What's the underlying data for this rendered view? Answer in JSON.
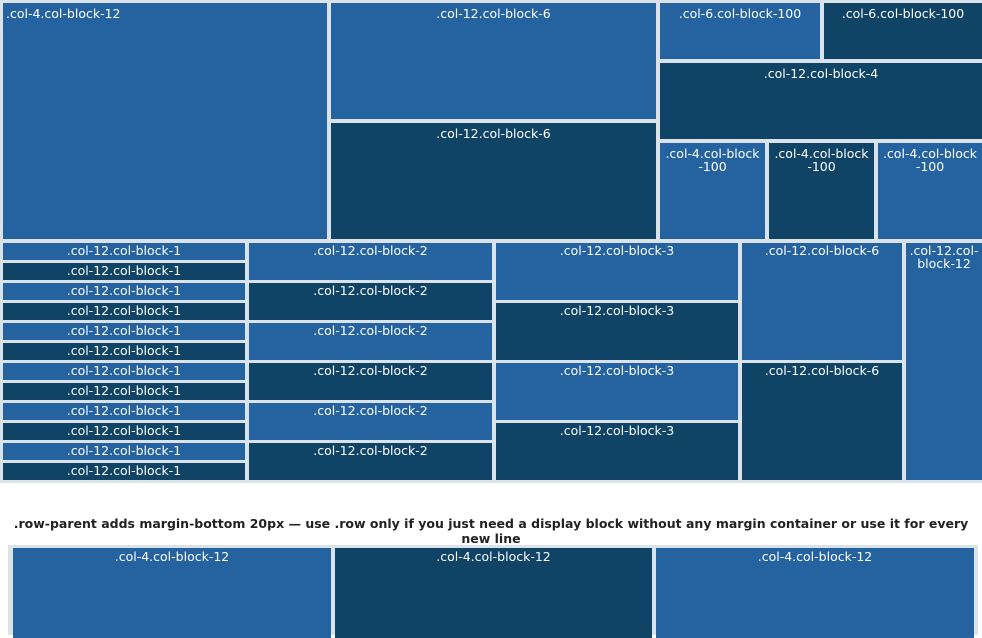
{
  "top_section": {
    "block_a": ".col-4.col-block-12",
    "block_b": ".col-12.col-block-6",
    "block_c": ".col-12.col-block-6",
    "block_d": ".col-6.col-block-100",
    "block_e": ".col-6.col-block-100",
    "block_f": ".col-12.col-block-4",
    "block_g": ".col-4.col-block-100",
    "block_h": ".col-4.col-block-100",
    "block_i": ".col-4.col-block-100"
  },
  "middle_section": {
    "column_1": [
      ".col-12.col-block-1",
      ".col-12.col-block-1",
      ".col-12.col-block-1",
      ".col-12.col-block-1",
      ".col-12.col-block-1",
      ".col-12.col-block-1",
      ".col-12.col-block-1",
      ".col-12.col-block-1",
      ".col-12.col-block-1",
      ".col-12.col-block-1",
      ".col-12.col-block-1",
      ".col-12.col-block-1"
    ],
    "column_2": [
      ".col-12.col-block-2",
      ".col-12.col-block-2",
      ".col-12.col-block-2",
      ".col-12.col-block-2",
      ".col-12.col-block-2",
      ".col-12.col-block-2"
    ],
    "column_3": [
      ".col-12.col-block-3",
      ".col-12.col-block-3",
      ".col-12.col-block-3",
      ".col-12.col-block-3"
    ],
    "column_4": [
      ".col-12.col-block-6",
      ".col-12.col-block-6"
    ],
    "column_5": [
      ".col-12.col-block-12"
    ]
  },
  "note": ".row-parent adds margin-bottom 20px — use .row only if you just need a display block without any margin container or use it for every new line",
  "bottom_section": [
    ".col-4.col-block-12",
    ".col-4.col-block-12",
    ".col-4.col-block-12"
  ],
  "colors": {
    "light_block": "#2563a0",
    "dark_block": "#0f4467",
    "gutter": "#dbe3ea"
  }
}
